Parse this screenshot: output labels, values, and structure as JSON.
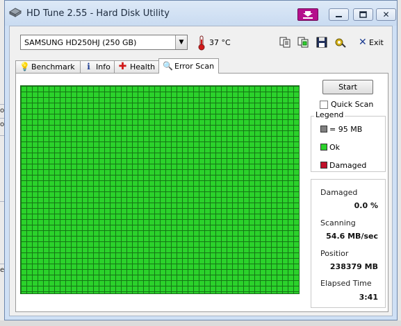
{
  "window": {
    "title": "HD Tune 2.55 - Hard Disk Utility",
    "minimize_glyph": "🗕",
    "maximize_glyph": "🗖",
    "close_glyph": "✕"
  },
  "toolbar": {
    "drive": "SAMSUNG HD250HJ (250 GB)",
    "temperature": "37 °C",
    "exit_label": "Exit",
    "icons": [
      "copy-text-icon",
      "copy-screenshot-icon",
      "save-icon",
      "options-icon"
    ]
  },
  "tabs": [
    {
      "label": "Benchmark",
      "icon": "benchmark-icon",
      "active": false
    },
    {
      "label": "Info",
      "icon": "info-icon",
      "active": false
    },
    {
      "label": "Health",
      "icon": "health-icon",
      "active": false
    },
    {
      "label": "Error Scan",
      "icon": "magnifier-icon",
      "active": true
    }
  ],
  "error_scan": {
    "start_label": "Start",
    "quick_scan_label": "Quick Scan",
    "quick_scan_checked": false,
    "legend": {
      "title": "Legend",
      "items": [
        {
          "label": "= 95 MB",
          "color": "#808080"
        },
        {
          "label": "Ok",
          "color": "#2bd22b"
        },
        {
          "label": "Damaged",
          "color": "#c0102a"
        }
      ]
    },
    "stats": {
      "damaged_label": "Damaged",
      "damaged_value": "0.0 %",
      "scanning_label": "Scanning",
      "scanning_value": "54.6 MB/sec",
      "position_label": "Positior",
      "position_value": "238379 MB",
      "elapsed_label": "Elapsed Time",
      "elapsed_value": "3:41"
    }
  },
  "colors": {
    "block_ok": "#2bd22b",
    "block_border": "#157515",
    "accent_drop_button": "#b50f8c"
  }
}
